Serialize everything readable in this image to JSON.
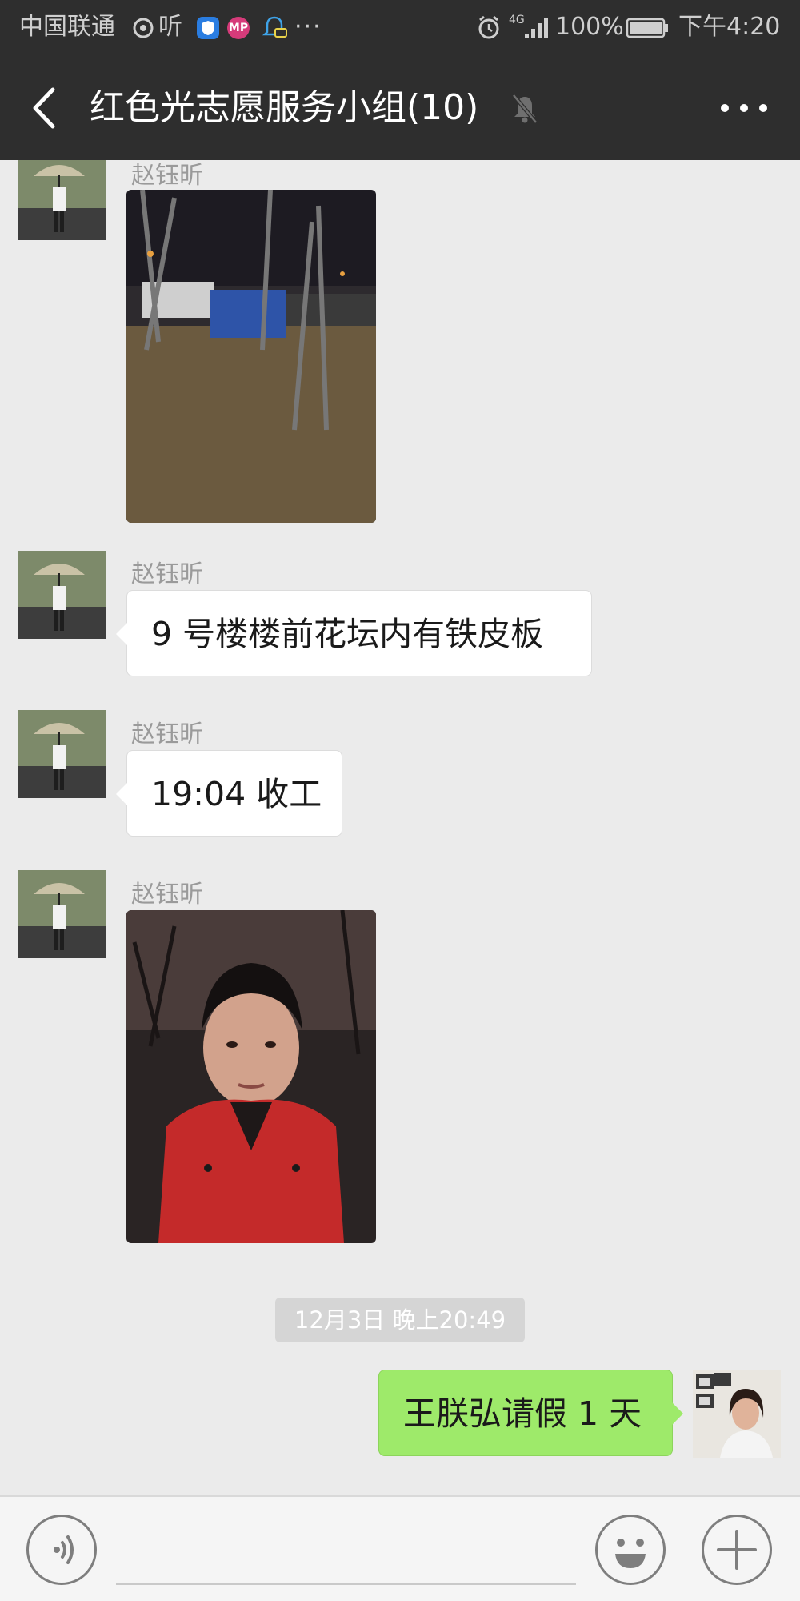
{
  "status_bar": {
    "carrier": "中国联通",
    "ting_label": "听",
    "mp_label": "MP",
    "more_dots": "···",
    "network": "4G",
    "battery_percent": "100%",
    "time": "下午4:20"
  },
  "header": {
    "title": "红色光志愿服务小组(10)"
  },
  "messages": [
    {
      "sender": "赵钰昕",
      "type": "image",
      "image": "night-yard-photo"
    },
    {
      "sender": "赵钰昕",
      "type": "text",
      "text": "9 号楼楼前花坛内有铁皮板"
    },
    {
      "sender": "赵钰昕",
      "type": "text",
      "text": "19:04 收工"
    },
    {
      "sender": "赵钰昕",
      "type": "image",
      "image": "volunteer-selfie-photo"
    }
  ],
  "timestamp": "12月3日 晚上20:49",
  "my_message": {
    "text": "王朕弘请假 1 天"
  },
  "input_bar": {
    "placeholder": ""
  },
  "colors": {
    "header_bg": "#2e2e2e",
    "chat_bg": "#ebebeb",
    "my_bubble": "#9eea6a",
    "other_bubble": "#ffffff",
    "timestamp_bg": "#d5d5d5"
  }
}
